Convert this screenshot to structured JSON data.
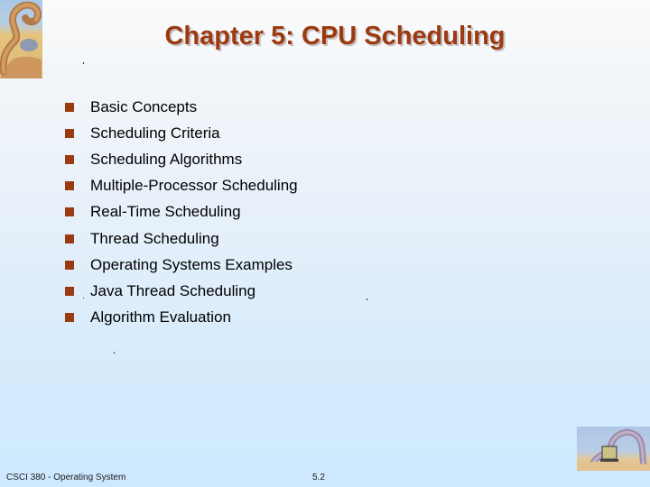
{
  "slide": {
    "title": "Chapter 5:  CPU Scheduling",
    "bullets": [
      "Basic Concepts",
      "Scheduling Criteria",
      "Scheduling Algorithms",
      "Multiple-Processor Scheduling",
      "Real-Time Scheduling",
      "Thread Scheduling",
      "Operating Systems Examples",
      "Java Thread Scheduling",
      "Algorithm Evaluation"
    ],
    "footer": {
      "course": "CSCI 380 - Operating System",
      "page_number": "5.2"
    },
    "colors": {
      "title": "#9b3a10",
      "bullet": "#9a3a10",
      "background_bottom": "#cde9ff"
    },
    "icons": {
      "top_left": "dinosaur-logo-icon",
      "bottom_right": "dinosaur-laptop-icon"
    }
  }
}
